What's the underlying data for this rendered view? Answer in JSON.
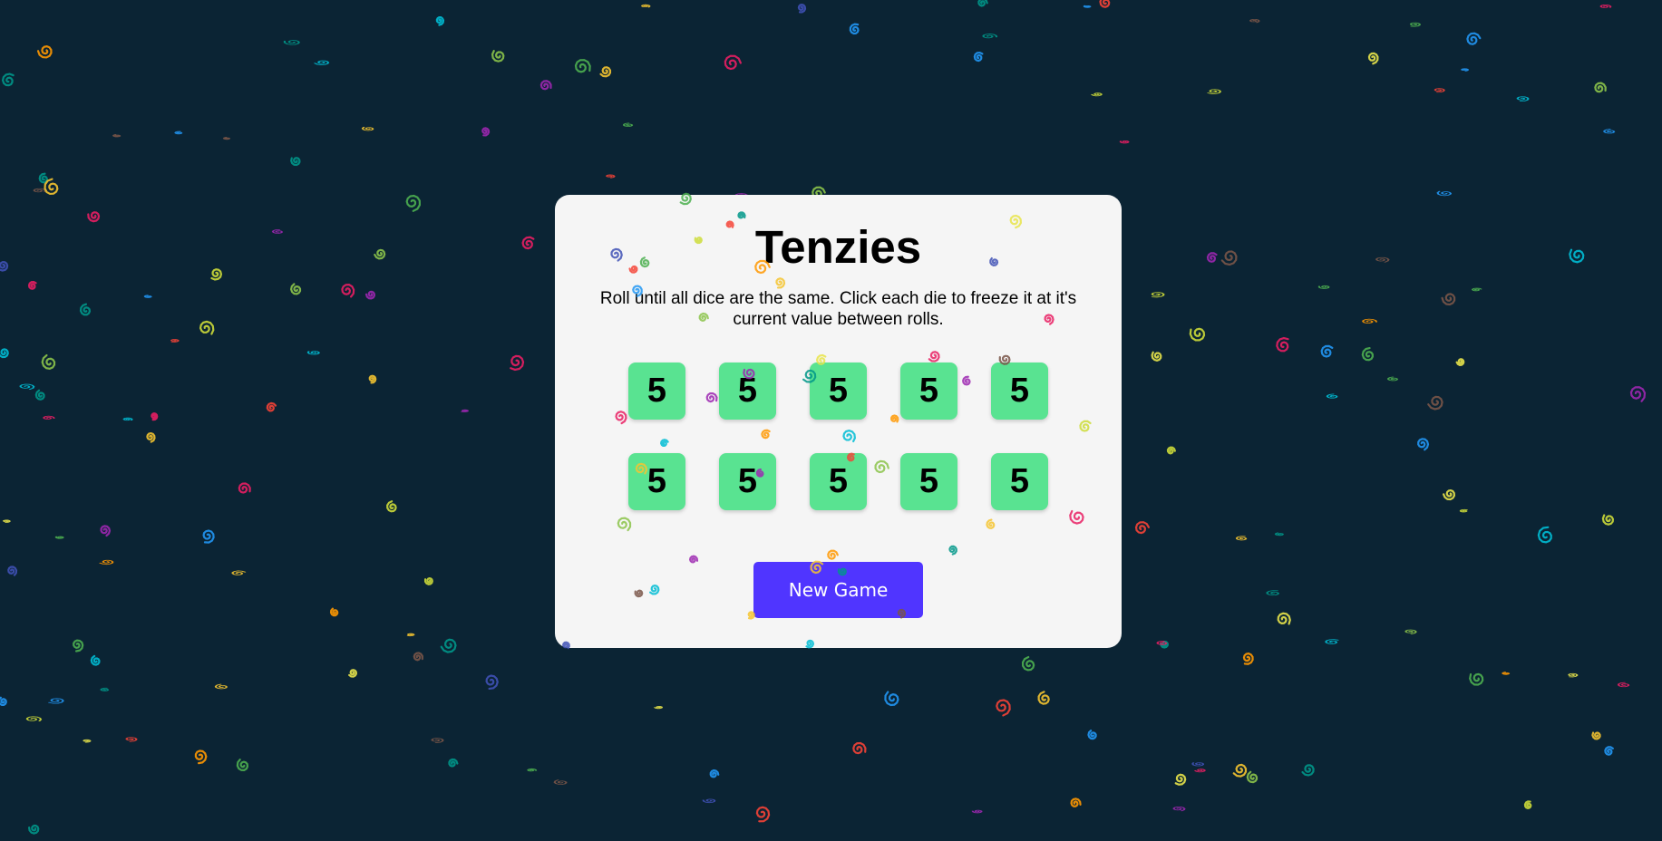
{
  "app": {
    "title": "Tenzies",
    "instructions": "Roll until all dice are the same. Click each die to freeze it at it's current value between rolls."
  },
  "dice": [
    {
      "value": "5"
    },
    {
      "value": "5"
    },
    {
      "value": "5"
    },
    {
      "value": "5"
    },
    {
      "value": "5"
    },
    {
      "value": "5"
    },
    {
      "value": "5"
    },
    {
      "value": "5"
    },
    {
      "value": "5"
    },
    {
      "value": "5"
    }
  ],
  "new_game_button": {
    "label": "New Game"
  },
  "colors": {
    "background": "#0b2434",
    "card": "#f5f5f5",
    "die": "#59e391",
    "button": "#5035ff",
    "confetti": [
      "#f4c430",
      "#e8e44a",
      "#2196f3",
      "#4caf50",
      "#9c27b0",
      "#f44336",
      "#ff9800",
      "#e91e63",
      "#795548",
      "#00bcd4",
      "#cddc39",
      "#3f51b5",
      "#8bc34a",
      "#009688"
    ]
  }
}
